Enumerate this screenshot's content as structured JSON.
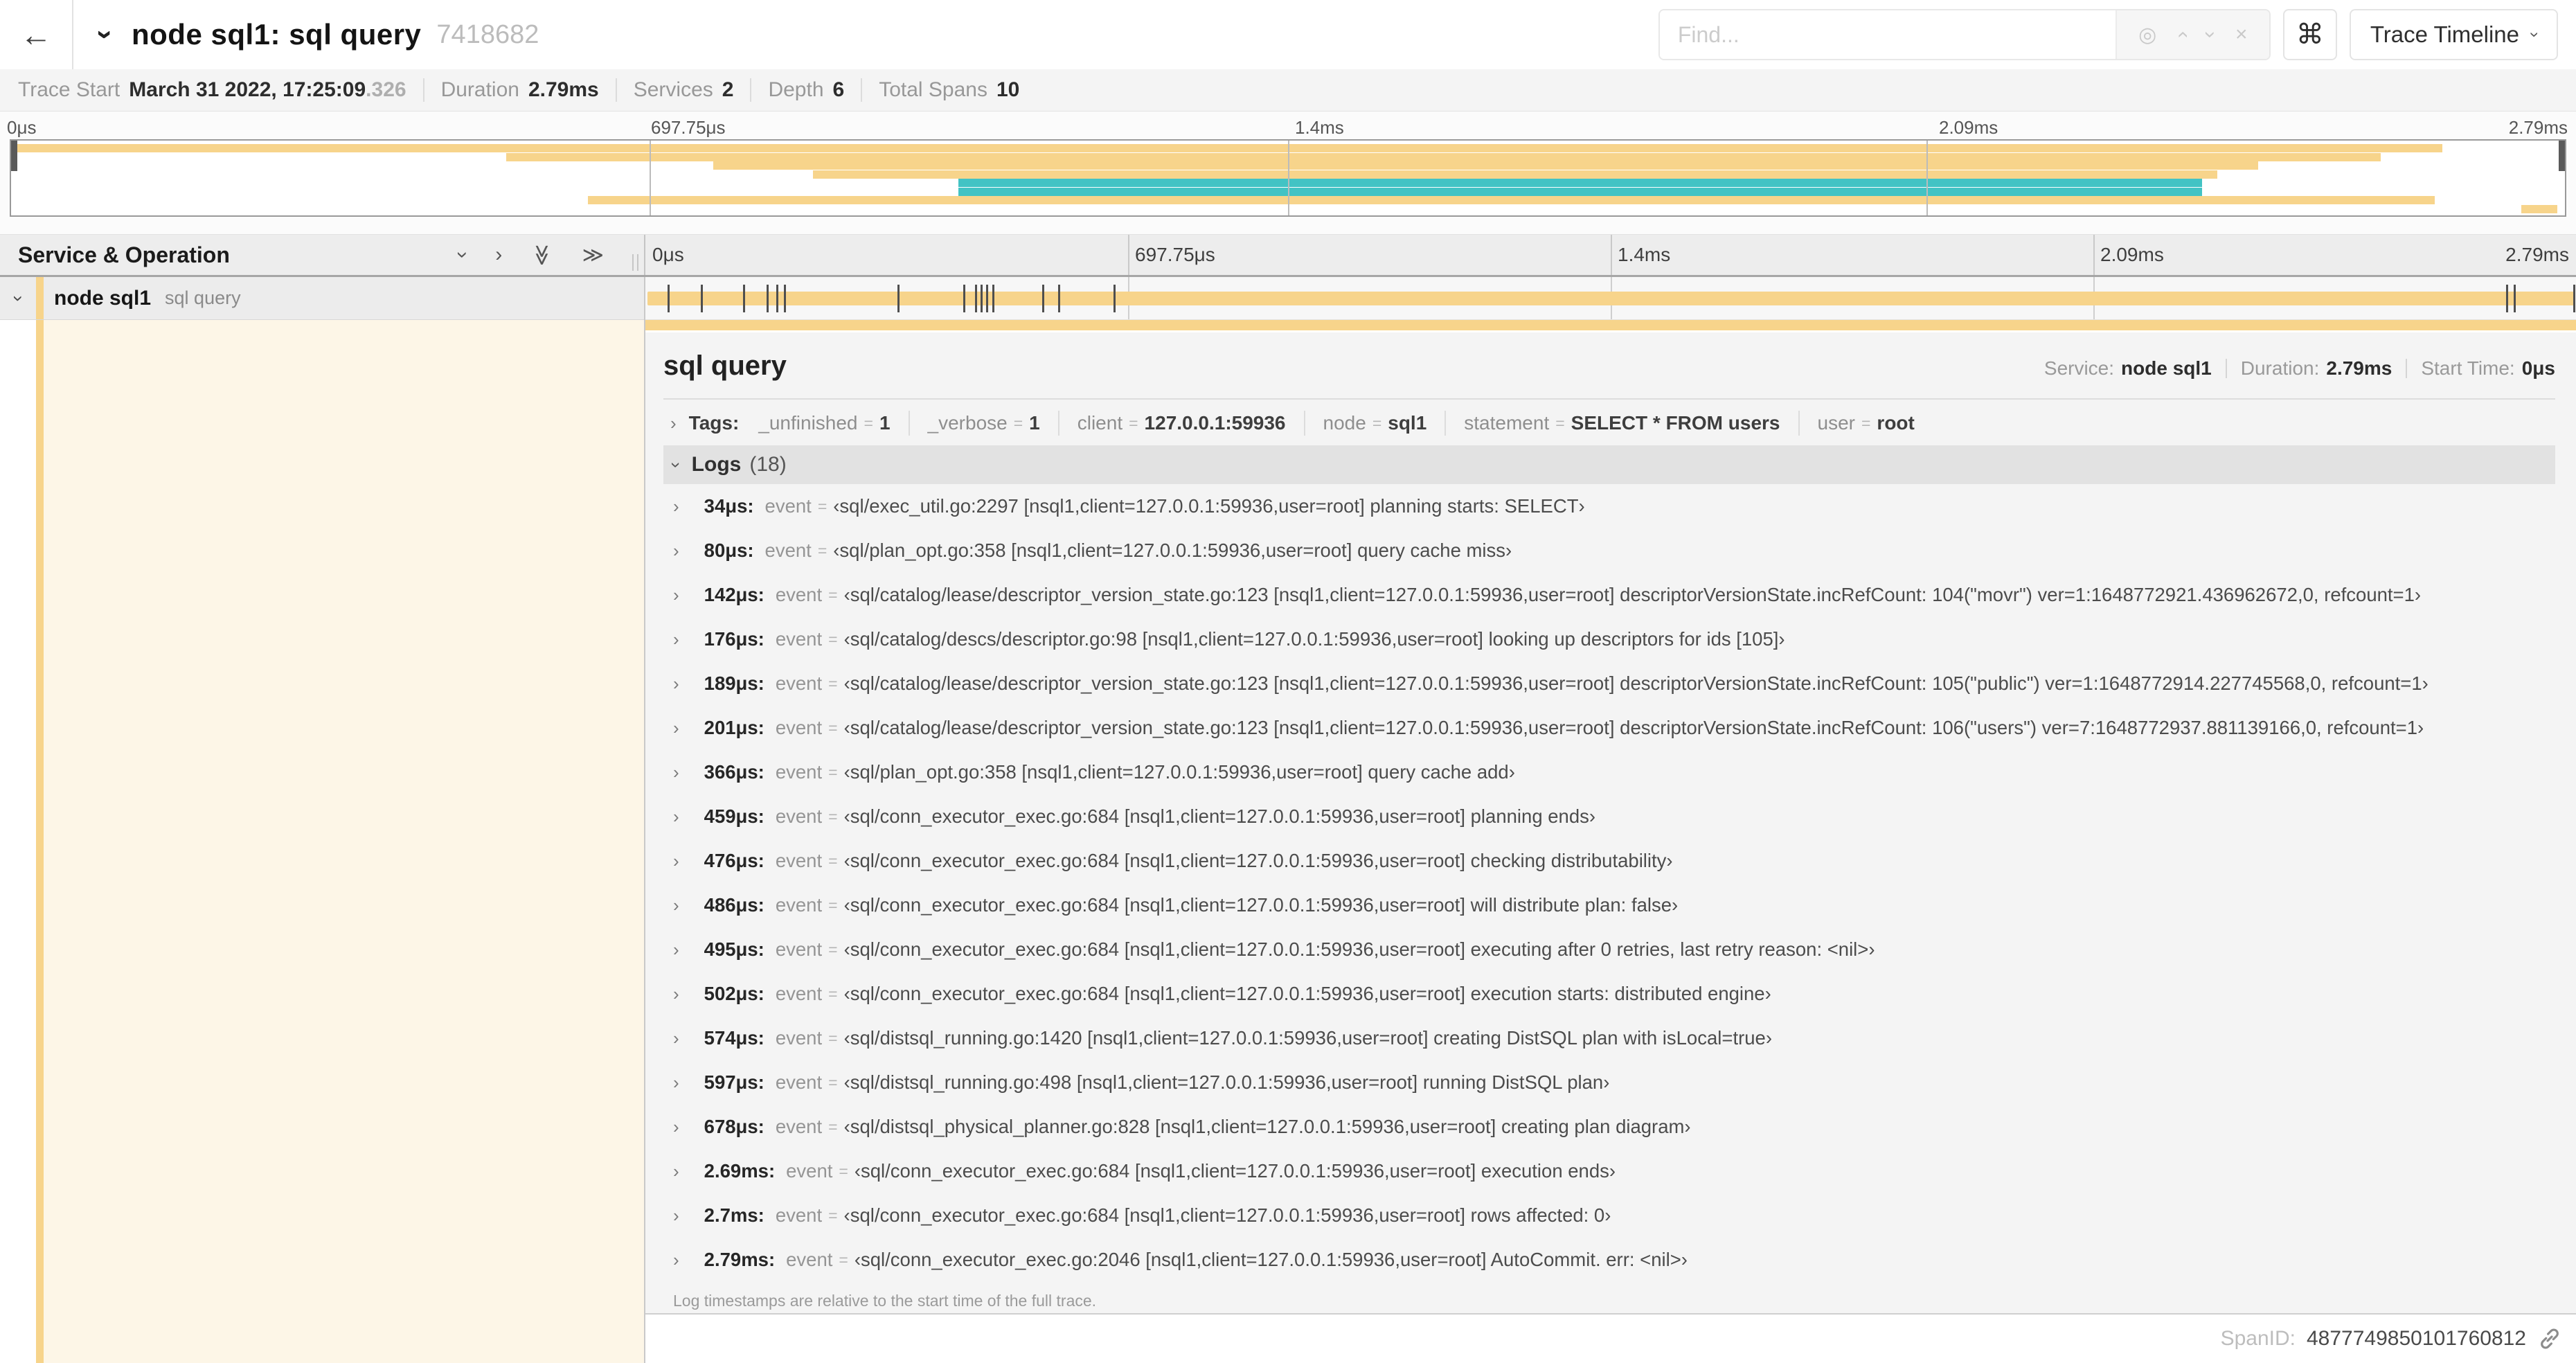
{
  "colors": {
    "span_tan": "#f7d48b",
    "span_teal": "#42c3c4",
    "detail_cream": "#fdf6e7"
  },
  "icons": {
    "back": "←",
    "chevron": "›",
    "double_chevron": "≫",
    "target": "◎",
    "close": "×",
    "command": "⌘"
  },
  "header": {
    "title": "node sql1: sql query",
    "trace_id": "7418682",
    "find_placeholder": "Find...",
    "view_selector": "Trace Timeline"
  },
  "summary": {
    "items": [
      {
        "label": "Trace Start",
        "value": "March 31 2022, 17:25:09",
        "suffix": ".326"
      },
      {
        "label": "Duration",
        "value": "2.79ms",
        "suffix": ""
      },
      {
        "label": "Services",
        "value": "2",
        "suffix": ""
      },
      {
        "label": "Depth",
        "value": "6",
        "suffix": ""
      },
      {
        "label": "Total Spans",
        "value": "10",
        "suffix": ""
      }
    ]
  },
  "chart_data": {
    "type": "gantt-minimap",
    "title": "trace span minimap",
    "x_axis_ticks": [
      {
        "label": "0μs",
        "pct": 0
      },
      {
        "label": "697.75μs",
        "pct": 25
      },
      {
        "label": "1.4ms",
        "pct": 50
      },
      {
        "label": "2.09ms",
        "pct": 75
      },
      {
        "label": "2.79ms",
        "pct": 100
      }
    ],
    "grid_pcts": [
      25,
      50,
      75
    ],
    "rows": [
      {
        "start": 0,
        "end": 95.2,
        "color": "tan"
      },
      {
        "start": 19.4,
        "end": 92.8,
        "color": "tan"
      },
      {
        "start": 27.5,
        "end": 88.0,
        "color": "tan"
      },
      {
        "start": 31.4,
        "end": 86.4,
        "color": "tan"
      },
      {
        "start": 37.1,
        "end": 85.8,
        "color": "teal"
      },
      {
        "start": 37.1,
        "end": 85.8,
        "color": "teal"
      },
      {
        "start": 22.6,
        "end": 94.9,
        "color": "tan"
      },
      {
        "start": 98.3,
        "end": 99.7,
        "color": "tan"
      }
    ]
  },
  "timeline": {
    "left_header": "Service & Operation",
    "ticks": [
      {
        "label": "0μs",
        "pct": 0
      },
      {
        "label": "697.75μs",
        "pct": 25
      },
      {
        "label": "1.4ms",
        "pct": 50
      },
      {
        "label": "2.09ms",
        "pct": 75
      },
      {
        "label": "2.79ms",
        "pct": 100
      }
    ],
    "grid_pcts": [
      25,
      50,
      75
    ],
    "span_row": {
      "service": "node sql1",
      "operation": "sql query",
      "bar_start_pct": 0,
      "bar_end_pct": 100,
      "log_marker_pcts": [
        1.2,
        2.9,
        5.1,
        6.3,
        6.8,
        7.2,
        13.1,
        16.5,
        17.1,
        17.4,
        17.7,
        18.0,
        20.6,
        21.4,
        24.3,
        96.4,
        96.8,
        99.9
      ]
    }
  },
  "detail": {
    "title": "sql query",
    "meta": [
      {
        "label": "Service:",
        "value": "node sql1"
      },
      {
        "label": "Duration:",
        "value": "2.79ms"
      },
      {
        "label": "Start Time:",
        "value": "0μs"
      }
    ],
    "tags": {
      "label": "Tags:",
      "items": [
        {
          "key": "_unfinished",
          "value": "1"
        },
        {
          "key": "_verbose",
          "value": "1"
        },
        {
          "key": "client",
          "value": "127.0.0.1:59936"
        },
        {
          "key": "node",
          "value": "sql1"
        },
        {
          "key": "statement",
          "value": "SELECT * FROM users"
        },
        {
          "key": "user",
          "value": "root"
        }
      ]
    },
    "logs": {
      "label": "Logs",
      "count": "(18)",
      "entries": [
        {
          "time": "34μs:",
          "key": "event",
          "value": "‹sql/exec_util.go:2297 [nsql1,client=127.0.0.1:59936,user=root] planning starts: SELECT›"
        },
        {
          "time": "80μs:",
          "key": "event",
          "value": "‹sql/plan_opt.go:358 [nsql1,client=127.0.0.1:59936,user=root] query cache miss›"
        },
        {
          "time": "142μs:",
          "key": "event",
          "value": "‹sql/catalog/lease/descriptor_version_state.go:123 [nsql1,client=127.0.0.1:59936,user=root] descriptorVersionState.incRefCount: 104(\"movr\") ver=1:1648772921.436962672,0, refcount=1›"
        },
        {
          "time": "176μs:",
          "key": "event",
          "value": "‹sql/catalog/descs/descriptor.go:98 [nsql1,client=127.0.0.1:59936,user=root] looking up descriptors for ids [105]›"
        },
        {
          "time": "189μs:",
          "key": "event",
          "value": "‹sql/catalog/lease/descriptor_version_state.go:123 [nsql1,client=127.0.0.1:59936,user=root] descriptorVersionState.incRefCount: 105(\"public\") ver=1:1648772914.227745568,0, refcount=1›"
        },
        {
          "time": "201μs:",
          "key": "event",
          "value": "‹sql/catalog/lease/descriptor_version_state.go:123 [nsql1,client=127.0.0.1:59936,user=root] descriptorVersionState.incRefCount: 106(\"users\") ver=7:1648772937.881139166,0, refcount=1›"
        },
        {
          "time": "366μs:",
          "key": "event",
          "value": "‹sql/plan_opt.go:358 [nsql1,client=127.0.0.1:59936,user=root] query cache add›"
        },
        {
          "time": "459μs:",
          "key": "event",
          "value": "‹sql/conn_executor_exec.go:684 [nsql1,client=127.0.0.1:59936,user=root] planning ends›"
        },
        {
          "time": "476μs:",
          "key": "event",
          "value": "‹sql/conn_executor_exec.go:684 [nsql1,client=127.0.0.1:59936,user=root] checking distributability›"
        },
        {
          "time": "486μs:",
          "key": "event",
          "value": "‹sql/conn_executor_exec.go:684 [nsql1,client=127.0.0.1:59936,user=root] will distribute plan: false›"
        },
        {
          "time": "495μs:",
          "key": "event",
          "value": "‹sql/conn_executor_exec.go:684 [nsql1,client=127.0.0.1:59936,user=root] executing after 0 retries, last retry reason: <nil>›"
        },
        {
          "time": "502μs:",
          "key": "event",
          "value": "‹sql/conn_executor_exec.go:684 [nsql1,client=127.0.0.1:59936,user=root] execution starts: distributed engine›"
        },
        {
          "time": "574μs:",
          "key": "event",
          "value": "‹sql/distsql_running.go:1420 [nsql1,client=127.0.0.1:59936,user=root] creating DistSQL plan with isLocal=true›"
        },
        {
          "time": "597μs:",
          "key": "event",
          "value": "‹sql/distsql_running.go:498 [nsql1,client=127.0.0.1:59936,user=root] running DistSQL plan›"
        },
        {
          "time": "678μs:",
          "key": "event",
          "value": "‹sql/distsql_physical_planner.go:828 [nsql1,client=127.0.0.1:59936,user=root] creating plan diagram›"
        },
        {
          "time": "2.69ms:",
          "key": "event",
          "value": "‹sql/conn_executor_exec.go:684 [nsql1,client=127.0.0.1:59936,user=root] execution ends›"
        },
        {
          "time": "2.7ms:",
          "key": "event",
          "value": "‹sql/conn_executor_exec.go:684 [nsql1,client=127.0.0.1:59936,user=root] rows affected: 0›"
        },
        {
          "time": "2.79ms:",
          "key": "event",
          "value": "‹sql/conn_executor_exec.go:2046 [nsql1,client=127.0.0.1:59936,user=root] AutoCommit. err: <nil>›"
        }
      ],
      "note": "Log timestamps are relative to the start time of the full trace."
    },
    "span_id_label": "SpanID:",
    "span_id": "4877749850101760812"
  }
}
